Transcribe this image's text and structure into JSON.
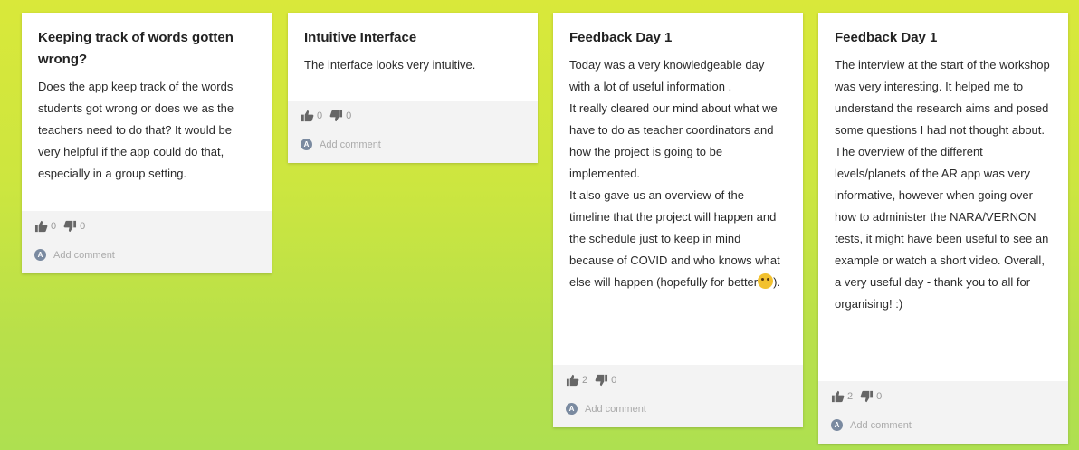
{
  "cards": [
    {
      "title": "Keeping track of words gotten wrong?",
      "paragraphs": [
        "Does the app keep track of the words students got wrong or does we as the teachers need to do that? It would be very helpful if the app could do that, especially in a group setting."
      ],
      "likes": "0",
      "dislikes": "0",
      "comment_placeholder": "Add comment",
      "avatar_initial": "A"
    },
    {
      "title": "Intuitive Interface",
      "paragraphs": [
        "The interface looks very intuitive."
      ],
      "likes": "0",
      "dislikes": "0",
      "comment_placeholder": "Add comment",
      "avatar_initial": "A"
    },
    {
      "title": "Feedback Day 1",
      "paragraphs": [
        "Today was a very knowledgeable day with a lot of  useful information .",
        "It really cleared our mind about what we have to do as teacher coordinators and how the project is going to be implemented.",
        "It also gave us an overview of the timeline that the project will happen and the schedule just to keep in mind because of COVID and who knows what else will happen (hopefully for better",
        ")."
      ],
      "likes": "2",
      "dislikes": "0",
      "comment_placeholder": "Add comment",
      "avatar_initial": "A"
    },
    {
      "title": "Feedback Day 1",
      "paragraphs": [
        "The interview at the start of the workshop was very interesting. It helped me to understand the research aims and posed some questions I had not thought about. The overview of the different levels/planets of the AR app was very informative, however when going over how to administer the NARA/VERNON tests, it might have been useful to see an example or watch a short video. Overall, a very useful day - thank you to all for organising! :)"
      ],
      "likes": "2",
      "dislikes": "0",
      "comment_placeholder": "Add comment",
      "avatar_initial": "A"
    }
  ],
  "icons": {
    "like": "thumbs-up-icon",
    "dislike": "thumbs-down-icon",
    "emoji": "smiley-emoji-icon"
  },
  "colors": {
    "background_top": "#d9e83a",
    "background_bottom": "#aee050",
    "card": "#ffffff",
    "footer": "#f3f3f3"
  }
}
